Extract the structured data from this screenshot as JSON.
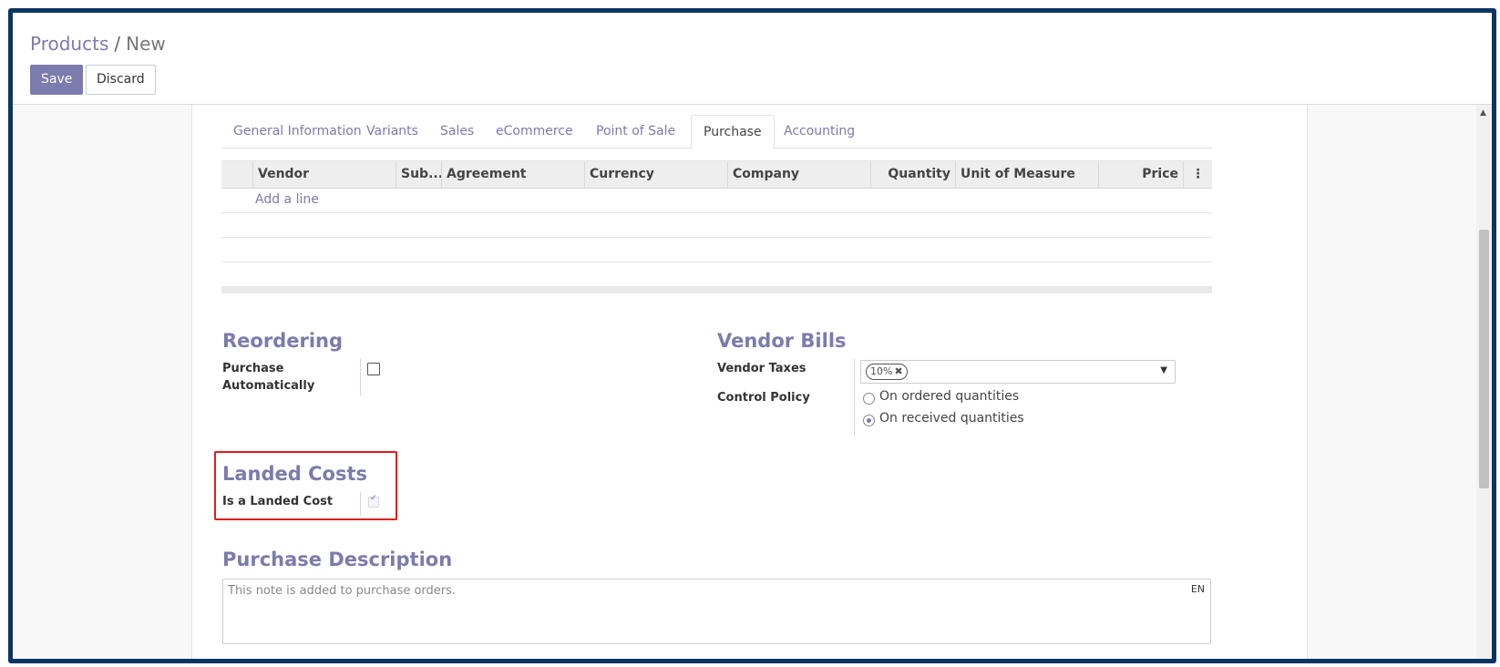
{
  "breadcrumb": {
    "parent": "Products",
    "separator": "/",
    "current": "New"
  },
  "buttons": {
    "save": "Save",
    "discard": "Discard"
  },
  "tabs": [
    {
      "label": "General Information"
    },
    {
      "label": "Variants"
    },
    {
      "label": "Sales"
    },
    {
      "label": "eCommerce"
    },
    {
      "label": "Point of Sale"
    },
    {
      "label": "Purchase",
      "active": true
    },
    {
      "label": "Accounting"
    }
  ],
  "vendor_table": {
    "columns": [
      "Vendor",
      "Sub...",
      "Agreement",
      "Currency",
      "Company",
      "Quantity",
      "Unit of Measure",
      "Price"
    ],
    "add_line": "Add a line"
  },
  "reordering": {
    "title": "Reordering",
    "purchase_auto_label_1": "Purchase",
    "purchase_auto_label_2": "Automatically",
    "purchase_auto_checked": false
  },
  "vendor_bills": {
    "title": "Vendor Bills",
    "vendor_taxes_label": "Vendor Taxes",
    "vendor_taxes_tag": "10%",
    "control_policy_label": "Control Policy",
    "options": [
      "On ordered quantities",
      "On received quantities"
    ],
    "selected": "On received quantities"
  },
  "landed_costs": {
    "title": "Landed Costs",
    "is_landed_cost_label": "Is a Landed Cost",
    "is_landed_cost_checked": true
  },
  "purchase_description": {
    "title": "Purchase Description",
    "placeholder": "This note is added to purchase orders.",
    "lang": "EN"
  },
  "colors": {
    "accent": "#7c7bad",
    "frame": "#0b3562",
    "highlight": "#e21b1b"
  }
}
